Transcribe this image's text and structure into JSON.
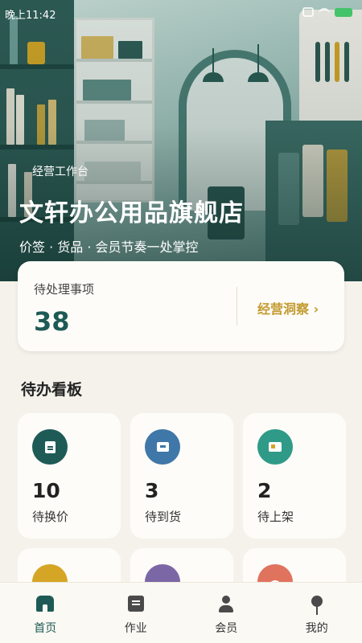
{
  "status_bar": {
    "time": "晚上11:42"
  },
  "hero": {
    "workbench_label": "经营工作台",
    "shop_name": "文轩办公用品旗舰店",
    "tagline": "价签 · 货品 · 会员节奏一处掌控"
  },
  "pending": {
    "label": "待处理事项",
    "count": "38",
    "insight_link": "经营洞察 ›"
  },
  "board": {
    "title": "待办看板",
    "tiles": [
      {
        "count": "10",
        "label": "待换价",
        "icon": "price-tag-icon",
        "color": "#1f5b56"
      },
      {
        "count": "3",
        "label": "待到货",
        "icon": "delivery-box-icon",
        "color": "#3f77a8"
      },
      {
        "count": "2",
        "label": "待上架",
        "icon": "shelf-icon",
        "color": "#2f9a87"
      },
      {
        "count": "",
        "label": "",
        "icon": "member-icon",
        "color": "#d5a625"
      },
      {
        "count": "",
        "label": "",
        "icon": "note-icon",
        "color": "#7c67a6"
      },
      {
        "count": "",
        "label": "",
        "icon": "alert-icon",
        "color": "#e0735e"
      }
    ]
  },
  "tabbar": {
    "tabs": [
      {
        "label": "首页",
        "icon": "home-icon",
        "active": true
      },
      {
        "label": "作业",
        "icon": "task-icon",
        "active": false
      },
      {
        "label": "会员",
        "icon": "member-icon",
        "active": false
      },
      {
        "label": "我的",
        "icon": "profile-icon",
        "active": false
      }
    ]
  },
  "colors": {
    "primary": "#1e5a55",
    "accent": "#c39a2e",
    "background": "#f5f2ec"
  }
}
